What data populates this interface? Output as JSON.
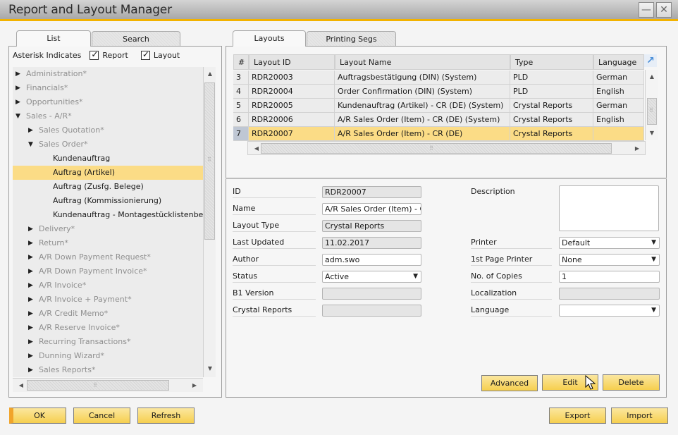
{
  "window": {
    "title": "Report and Layout Manager",
    "minimize_icon": "minimize-icon",
    "close_icon": "close-icon"
  },
  "left_tabs": [
    {
      "label": "List",
      "active": true
    },
    {
      "label": "Search",
      "active": false,
      "mnemonic": "S"
    }
  ],
  "asterisk": {
    "label": "Asterisk Indicates",
    "report": {
      "label": "Report",
      "checked": true
    },
    "layout": {
      "label": "Layout",
      "checked": true
    }
  },
  "tree": [
    {
      "label": "Administration*",
      "level": 0,
      "state": "collapsed",
      "style": "grey"
    },
    {
      "label": "Financials*",
      "level": 0,
      "state": "collapsed",
      "style": "grey"
    },
    {
      "label": "Opportunities*",
      "level": 0,
      "state": "collapsed",
      "style": "grey"
    },
    {
      "label": "Sales - A/R*",
      "level": 0,
      "state": "expanded",
      "style": "grey"
    },
    {
      "label": "Sales Quotation*",
      "level": 1,
      "state": "collapsed",
      "style": "grey"
    },
    {
      "label": "Sales Order*",
      "level": 1,
      "state": "expanded",
      "style": "grey"
    },
    {
      "label": "Kundenauftrag",
      "level": 2,
      "state": "leaf",
      "style": "dark"
    },
    {
      "label": "Auftrag (Artikel)",
      "level": 2,
      "state": "leaf",
      "style": "dark",
      "selected": true
    },
    {
      "label": "Auftrag (Zusfg. Belege)",
      "level": 2,
      "state": "leaf",
      "style": "dark"
    },
    {
      "label": "Auftrag (Kommissionierung)",
      "level": 2,
      "state": "leaf",
      "style": "dark"
    },
    {
      "label": "Kundenauftrag - Montagestücklistenbe",
      "level": 2,
      "state": "leaf",
      "style": "dark"
    },
    {
      "label": "Delivery*",
      "level": 1,
      "state": "collapsed",
      "style": "grey"
    },
    {
      "label": "Return*",
      "level": 1,
      "state": "collapsed",
      "style": "grey"
    },
    {
      "label": "A/R Down Payment Request*",
      "level": 1,
      "state": "collapsed",
      "style": "grey"
    },
    {
      "label": "A/R Down Payment Invoice*",
      "level": 1,
      "state": "collapsed",
      "style": "grey"
    },
    {
      "label": "A/R Invoice*",
      "level": 1,
      "state": "collapsed",
      "style": "grey"
    },
    {
      "label": "A/R Invoice + Payment*",
      "level": 1,
      "state": "collapsed",
      "style": "grey"
    },
    {
      "label": "A/R Credit Memo*",
      "level": 1,
      "state": "collapsed",
      "style": "grey"
    },
    {
      "label": "A/R Reserve Invoice*",
      "level": 1,
      "state": "collapsed",
      "style": "grey"
    },
    {
      "label": "Recurring Transactions*",
      "level": 1,
      "state": "collapsed",
      "style": "grey"
    },
    {
      "label": "Dunning Wizard*",
      "level": 1,
      "state": "collapsed",
      "style": "grey"
    },
    {
      "label": "Sales Reports*",
      "level": 1,
      "state": "collapsed",
      "style": "grey"
    }
  ],
  "left_buttons": {
    "ok": "OK",
    "cancel": "Cancel",
    "refresh": "Refresh"
  },
  "right_tabs": [
    {
      "label": "Layouts",
      "active": true
    },
    {
      "label": "Printing Segs",
      "active": false
    }
  ],
  "layouts_table": {
    "columns": [
      "#",
      "Layout ID",
      "Layout Name",
      "Type",
      "Language"
    ],
    "rows": [
      {
        "num": "3",
        "id": "RDR20003",
        "name": "Auftragsbestätigung (DIN) (System)",
        "type": "PLD",
        "language": "German"
      },
      {
        "num": "4",
        "id": "RDR20004",
        "name": "Order Confirmation (DIN) (System)",
        "type": "PLD",
        "language": "English"
      },
      {
        "num": "5",
        "id": "RDR20005",
        "name": "Kundenauftrag (Artikel) - CR (DE) (System)",
        "type": "Crystal Reports",
        "language": "German"
      },
      {
        "num": "6",
        "id": "RDR20006",
        "name": "A/R Sales Order (Item) - CR (DE) (System)",
        "type": "Crystal Reports",
        "language": "English"
      },
      {
        "num": "7",
        "id": "RDR20007",
        "name": "A/R Sales Order (Item) - CR (DE)",
        "type": "Crystal Reports",
        "language": "",
        "selected": true
      }
    ]
  },
  "details": {
    "left": [
      {
        "label": "ID",
        "value": "RDR20007",
        "kind": "readonly"
      },
      {
        "label": "Name",
        "value": "A/R Sales Order (Item) - CR (DE)",
        "kind": "text"
      },
      {
        "label": "Layout Type",
        "value": "Crystal Reports",
        "kind": "readonly"
      },
      {
        "label": "Last Updated",
        "value": "11.02.2017",
        "kind": "readonly"
      },
      {
        "label": "Author",
        "value": "adm.swo",
        "kind": "text"
      },
      {
        "label": "Status",
        "value": "Active",
        "kind": "select"
      },
      {
        "label": "B1 Version",
        "value": "",
        "kind": "readonly"
      },
      {
        "label": "Crystal Reports",
        "value": "",
        "kind": "readonly"
      }
    ],
    "description": {
      "label": "Description",
      "value": ""
    },
    "right": [
      {
        "label": "Printer",
        "value": "Default",
        "kind": "select"
      },
      {
        "label": "1st Page Printer",
        "value": "None",
        "kind": "select"
      },
      {
        "label": "No. of Copies",
        "value": "1",
        "kind": "text"
      },
      {
        "label": "Localization",
        "value": "",
        "kind": "readonly"
      },
      {
        "label": "Language",
        "value": "",
        "kind": "select"
      }
    ]
  },
  "right_buttons": {
    "advanced": "Advanced",
    "edit": "Edit",
    "delete": "Delete",
    "export": "Export",
    "import": "Import"
  }
}
